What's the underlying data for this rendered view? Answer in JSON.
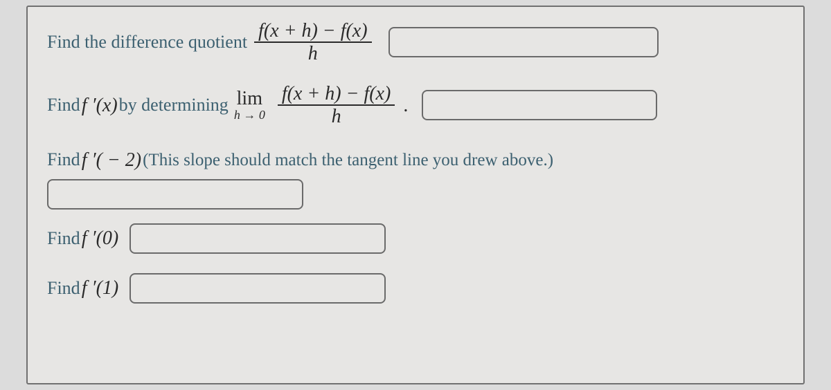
{
  "q1": {
    "prompt_before": "Find the difference quotient",
    "frac_num": "f(x + h) − f(x)",
    "frac_den": "h"
  },
  "q2": {
    "prompt_before": "Find",
    "func": "f ′(x)",
    "by": "by determining",
    "lim_label": "lim",
    "lim_sub": "h → 0",
    "frac_num": "f(x + h) − f(x)",
    "frac_den": "h",
    "dot": "."
  },
  "q3": {
    "prompt_before": "Find",
    "func": "f ′( − 2)",
    "note": "(This slope should match the tangent line you drew above.)"
  },
  "q4": {
    "prompt_before": "Find",
    "func": "f ′(0)"
  },
  "q5": {
    "prompt_before": "Find",
    "func": "f ′(1)"
  }
}
